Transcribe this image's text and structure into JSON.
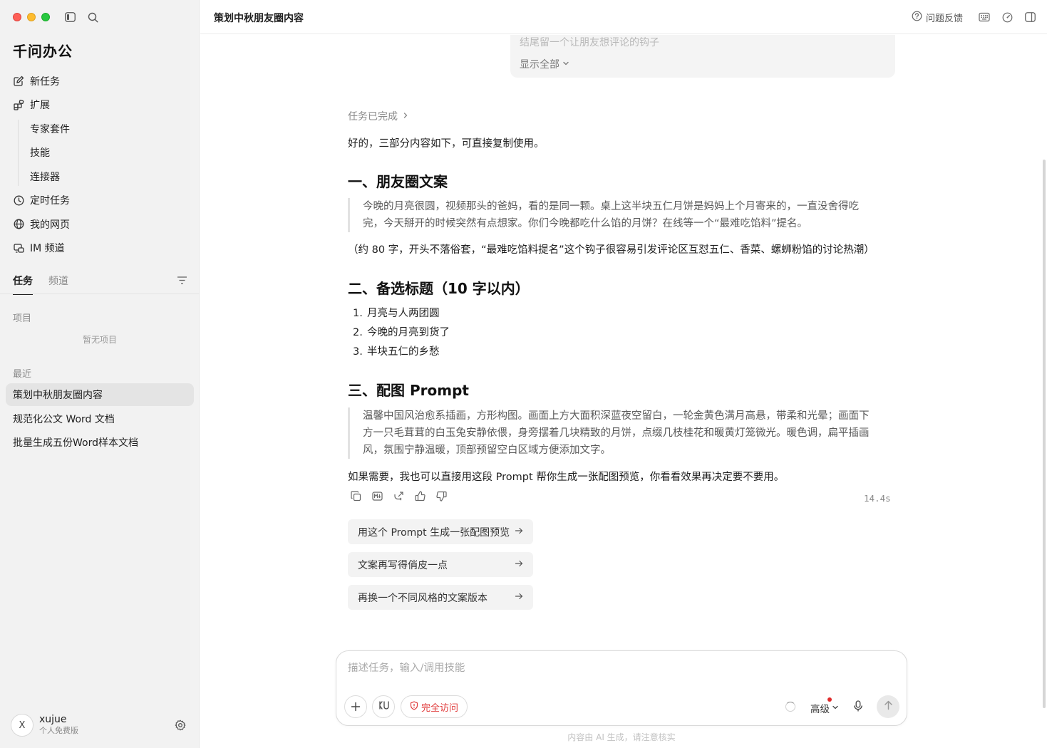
{
  "app": {
    "brand": "千问办公"
  },
  "sidebar": {
    "nav": [
      {
        "label": "新任务",
        "icon": "edit-icon"
      },
      {
        "label": "扩展",
        "icon": "extension-icon"
      },
      {
        "label": "专家套件",
        "sub": true
      },
      {
        "label": "技能",
        "sub": true
      },
      {
        "label": "连接器",
        "sub": true
      },
      {
        "label": "定时任务",
        "icon": "clock-icon"
      },
      {
        "label": "我的网页",
        "icon": "globe-icon"
      },
      {
        "label": "IM 频道",
        "icon": "im-channel-icon"
      }
    ],
    "tabs": {
      "tasks": "任务",
      "channels": "频道"
    },
    "projects_label": "项目",
    "projects_empty": "暂无项目",
    "recent_label": "最近",
    "recent": [
      {
        "label": "策划中秋朋友圈内容",
        "active": true
      },
      {
        "label": "规范化公文 Word 文档",
        "active": false
      },
      {
        "label": "批量生成五份Word样本文档",
        "active": false
      }
    ],
    "user": {
      "avatar_letter": "X",
      "name": "xujue",
      "plan": "个人免费版"
    }
  },
  "header": {
    "title": "策划中秋朋友圈内容",
    "feedback": "问题反馈"
  },
  "main": {
    "prev_card": {
      "partial_line": "结尾留一个让朋友想评论的钩子",
      "show_all": "显示全部"
    },
    "task_status": "任务已完成",
    "intro": "好的，三部分内容如下，可直接复制使用。",
    "section1": {
      "heading": "一、朋友圈文案",
      "quote": "今晚的月亮很圆，视频那头的爸妈，看的是同一颗。桌上这半块五仁月饼是妈妈上个月寄来的，一直没舍得吃完，今天掰开的时候突然有点想家。你们今晚都吃什么馅的月饼？在线等一个“最难吃馅料”提名。",
      "note": "（约 80 字，开头不落俗套，“最难吃馅料提名”这个钩子很容易引发评论区互怼五仁、香菜、螺蛳粉馅的讨论热潮）"
    },
    "section2": {
      "heading": "二、备选标题（10 字以内）",
      "items": [
        {
          "num": "1.",
          "text": "月亮与人两团圆"
        },
        {
          "num": "2.",
          "text": "今晚的月亮到货了"
        },
        {
          "num": "3.",
          "text": "半块五仁的乡愁"
        }
      ]
    },
    "section3": {
      "heading": "三、配图 Prompt",
      "quote": "温馨中国风治愈系插画，方形构图。画面上方大面积深蓝夜空留白，一轮金黄色满月高悬，带柔和光晕；画面下方一只毛茸茸的白玉兔安静依偎，身旁摆着几块精致的月饼，点缀几枝桂花和暖黄灯笼微光。暖色调，扁平插画风，氛围宁静温暖，顶部预留空白区域方便添加文字。"
    },
    "closing": "如果需要，我也可以直接用这段 Prompt 帮你生成一张配图预览，你看看效果再决定要不要用。",
    "elapsed": "14.4s",
    "suggestions": [
      "用这个 Prompt 生成一张配图预览",
      "文案再写得俏皮一点",
      "再换一个不同风格的文案版本"
    ]
  },
  "composer": {
    "placeholder": "描述任务，输入/调用技能",
    "access_label": "完全访问",
    "level_label": "高级",
    "disclaimer": "内容由 AI 生成，请注意核实"
  },
  "colors": {
    "sidebar_bg": "#f2f2f2",
    "accent_red": "#e03a3a",
    "active_item_bg": "#e4e4e4"
  }
}
